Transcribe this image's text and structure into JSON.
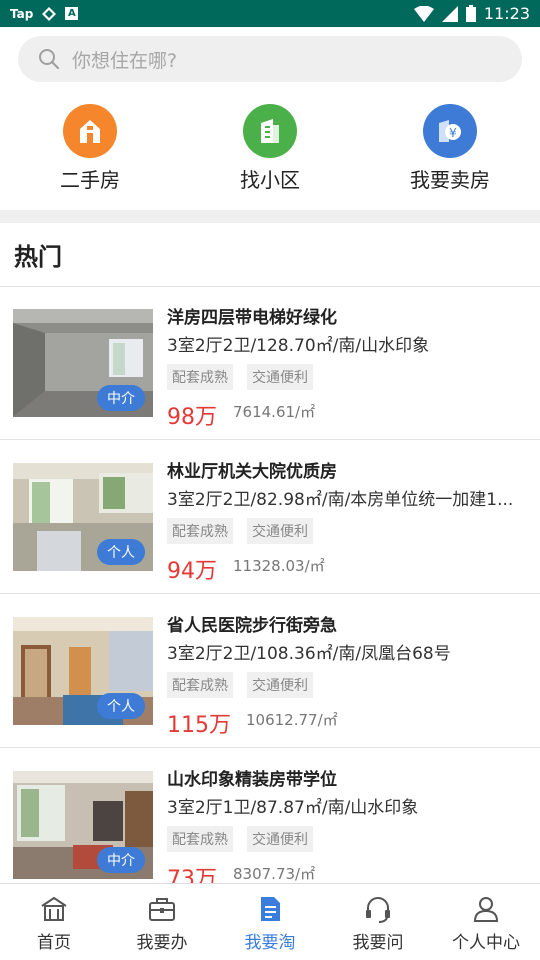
{
  "status_bar": {
    "app_badge": "Tap",
    "time": "11:23",
    "a_icon": "A"
  },
  "search": {
    "placeholder": "你想住在哪?"
  },
  "quick_links": [
    {
      "label": "二手房",
      "icon": "house-icon",
      "color": "#f5862b"
    },
    {
      "label": "找小区",
      "icon": "building-icon",
      "color": "#4cb04a"
    },
    {
      "label": "我要卖房",
      "icon": "sell-house-icon",
      "color": "#3d7bd6"
    }
  ],
  "hot": {
    "title": "热门",
    "listings": [
      {
        "title": "洋房四层带电梯好绿化",
        "spec": "3室2厅2卫/128.70㎡/南/山水印象",
        "tags": [
          "配套成熟",
          "交通便利"
        ],
        "price": "98万",
        "unit_price": "7614.61/㎡",
        "badge": "中介"
      },
      {
        "title": "林业厅机关大院优质房",
        "spec": " 3室2厅2卫/82.98㎡/南/本房单位统一加建1...",
        "tags": [
          "配套成熟",
          "交通便利"
        ],
        "price": "94万",
        "unit_price": "11328.03/㎡",
        "badge": "个人"
      },
      {
        "title": "省人民医院步行街旁急",
        "spec": "3室2厅2卫/108.36㎡/南/凤凰台68号",
        "tags": [
          "配套成熟",
          "交通便利"
        ],
        "price": "115万",
        "unit_price": "10612.77/㎡",
        "badge": "个人"
      },
      {
        "title": "山水印象精装房带学位",
        "spec": "3室2厅1卫/87.87㎡/南/山水印象",
        "tags": [
          "配套成熟",
          "交通便利"
        ],
        "price": "73万",
        "unit_price": "8307.73/㎡",
        "badge": "中介"
      }
    ]
  },
  "bottom_nav": [
    {
      "label": "首页",
      "icon": "home-icon",
      "active": false
    },
    {
      "label": "我要办",
      "icon": "briefcase-icon",
      "active": false
    },
    {
      "label": "我要淘",
      "icon": "document-icon",
      "active": true
    },
    {
      "label": "我要问",
      "icon": "headset-icon",
      "active": false
    },
    {
      "label": "个人中心",
      "icon": "person-icon",
      "active": false
    }
  ],
  "colors": {
    "accent": "#3b7ddd",
    "price": "#e53935",
    "status_bar": "#00695c"
  }
}
